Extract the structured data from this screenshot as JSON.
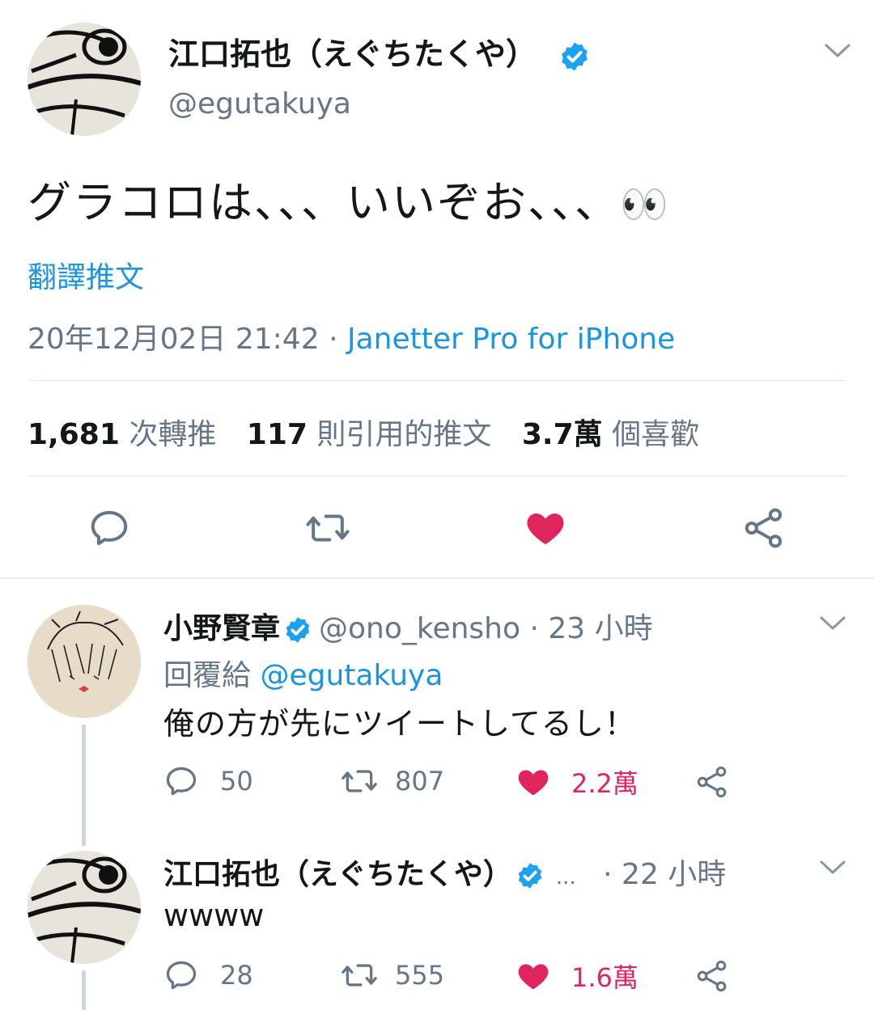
{
  "main_tweet": {
    "display_name": "江口拓也（えぐちたくや）",
    "handle": "@egutakuya",
    "text": "グラコロは、、、いいぞお、、、",
    "emoji": "👀",
    "translate_label": "翻譯推文",
    "timestamp": "20年12月02日 21:42",
    "separator": "·",
    "source": "Janetter Pro for iPhone",
    "stats": {
      "retweets_count": "1,681",
      "retweets_label": "次轉推",
      "quotes_count": "117",
      "quotes_label": "則引用的推文",
      "likes_count": "3.7萬",
      "likes_label": "個喜歡"
    },
    "icons": [
      "reply-icon",
      "retweet-icon",
      "heart-icon",
      "share-icon"
    ]
  },
  "replies": [
    {
      "display_name": "小野賢章",
      "handle": "@ono_kensho",
      "time": "· 23 小時",
      "reply_to_label": "回覆給",
      "reply_to_handle": "@egutakuya",
      "text": "俺の方が先にツイートしてるし！",
      "reply_count": "50",
      "retweet_count": "807",
      "like_count": "2.2萬"
    },
    {
      "display_name": "江口拓也（えぐちたくや）",
      "handle_truncated": "...",
      "time": "· 22 小時",
      "text": "wwww",
      "reply_count": "28",
      "retweet_count": "555",
      "like_count": "1.6萬"
    }
  ],
  "colors": {
    "link_blue": "#1b95e0",
    "like_pink": "#e0245e",
    "muted_gray": "#657786",
    "verified_blue": "#1da1f2"
  }
}
